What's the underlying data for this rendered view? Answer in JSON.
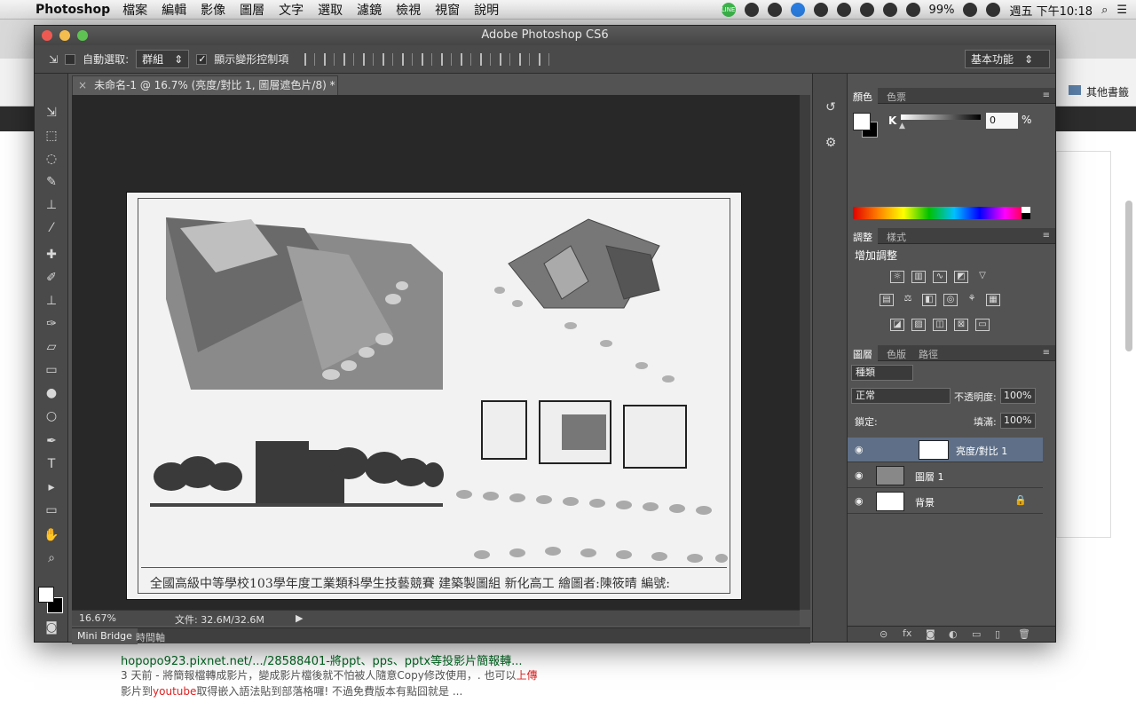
{
  "menubar": {
    "app_name": "Photoshop",
    "items": [
      "檔案",
      "編輯",
      "影像",
      "圖層",
      "文字",
      "選取",
      "濾鏡",
      "檢視",
      "視窗",
      "說明"
    ],
    "battery": "99%",
    "clock": "週五 下午10:18"
  },
  "browser": {
    "bookmark_other": "其他書籤",
    "result_url": "hopopo923.pixnet.net/.../28588401-將ppt、pps、pptx等投影片簡報轉...",
    "result_line1_a": "3 天前 - 將簡報檔轉成影片，變成影片檔後就不怕被人隨意Copy修改使用，. 也可以",
    "result_line1_b": "上傳",
    "result_line2_a": "影片到",
    "result_line2_b": "youtube",
    "result_line2_c": "取得嵌入語法貼到部落格囉! 不過免費版本有點囧就是 ..."
  },
  "photoshop": {
    "window_title": "Adobe Photoshop CS6",
    "options": {
      "auto_select_label": "自動選取:",
      "auto_select_value": "群組",
      "show_transform_label": "顯示變形控制項",
      "workspace": "基本功能"
    },
    "document": {
      "tab_title": "未命名-1 @ 16.7% (亮度/對比 1, 圖層遮色片/8) *",
      "caption": "全國高級中等學校103學年度工業類科學生技藝競賽 建築製圖組 新化高工 繪圖者:陳筱晴 編號:",
      "zoom": "16.67%",
      "file_size": "文件: 32.6M/32.6M"
    },
    "bottom_tabs": [
      "Mini Bridge",
      "時間軸"
    ],
    "color_panel": {
      "tabs": [
        "顏色",
        "色票"
      ],
      "channel": "K",
      "value": "0",
      "unit": "%"
    },
    "adjust_panel": {
      "tabs": [
        "調整",
        "樣式"
      ],
      "title": "增加調整"
    },
    "layers_panel": {
      "tabs": [
        "圖層",
        "色版",
        "路徑"
      ],
      "filter": "種類",
      "blend_mode": "正常",
      "opacity_label": "不透明度:",
      "opacity": "100%",
      "lock_label": "鎖定:",
      "fill_label": "填滿:",
      "fill": "100%",
      "layers": [
        {
          "name": "亮度/對比 1",
          "selected": true
        },
        {
          "name": "圖層 1",
          "selected": false
        },
        {
          "name": "背景",
          "selected": false
        }
      ]
    }
  }
}
